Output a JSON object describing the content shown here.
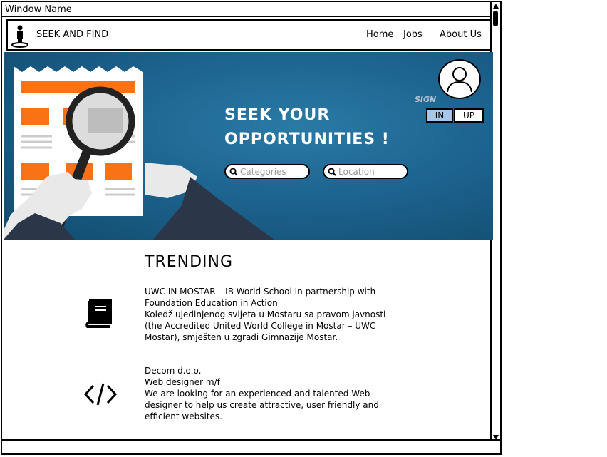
{
  "window": {
    "title": "Window Name"
  },
  "navbar": {
    "brand": "SEEK AND FIND",
    "links": [
      {
        "label": "Home"
      },
      {
        "label": "Jobs"
      },
      {
        "label": "About Us"
      }
    ],
    "logo_icon": "person-pin-icon"
  },
  "hero": {
    "title_line1": "SEEK YOUR",
    "title_line2": "OPPORTUNITIES !",
    "search": {
      "categories_placeholder": "Categories",
      "location_placeholder": "Location"
    },
    "account": {
      "avatar_icon": "user-avatar-icon",
      "sign_label": "SIGN",
      "in_label": "IN",
      "up_label": "UP"
    },
    "colors": {
      "background": "#1d6490",
      "in_button": "#a8c6ec",
      "accent": "#f97316"
    }
  },
  "trending": {
    "title": "TRENDING",
    "items": [
      {
        "icon": "book-icon",
        "lines": [
          "UWC IN MOSTAR – IB World School In partnership with",
          "Foundation Education in Action",
          "Koledž ujedinjenog svijeta u Mostaru sa pravom javnosti",
          "(the Accredited United World College in Mostar – UWC",
          "Mostar), smješten u zgradi Gimnazije Mostar."
        ]
      },
      {
        "icon": "code-icon",
        "lines": [
          "Decom d.o.o.",
          "Web designer m/f",
          "We are looking for an experienced and talented Web",
          "designer to help us create attractive, user friendly and",
          "efficient websites."
        ]
      }
    ]
  }
}
